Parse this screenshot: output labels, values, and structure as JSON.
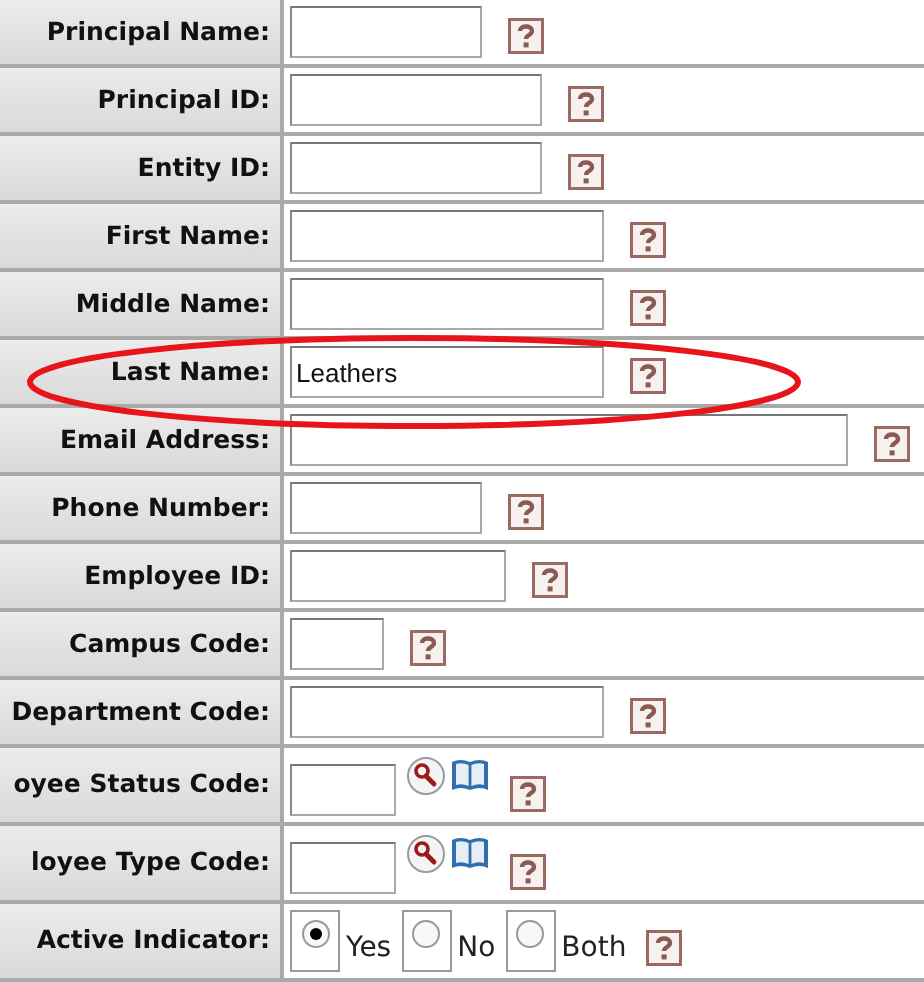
{
  "fields": [
    {
      "label": "Principal Name:",
      "kind": "text",
      "highlighted": false
    },
    {
      "label": "Principal ID:",
      "kind": "text",
      "highlighted": false
    },
    {
      "label": "Entity ID:",
      "kind": "text",
      "highlighted": false
    },
    {
      "label": "First Name:",
      "kind": "text",
      "highlighted": false
    },
    {
      "label": "Middle Name:",
      "kind": "text",
      "highlighted": false
    },
    {
      "label": "Last Name:",
      "kind": "text",
      "value": "Leathers",
      "highlighted": true
    },
    {
      "label": "Email Address:",
      "kind": "text",
      "highlighted": false
    },
    {
      "label": "Phone Number:",
      "kind": "text",
      "highlighted": false
    },
    {
      "label": "Employee ID:",
      "kind": "text",
      "highlighted": false
    },
    {
      "label": "Campus Code:",
      "kind": "text",
      "highlighted": false
    },
    {
      "label": "Department Code:",
      "kind": "text",
      "highlighted": false
    },
    {
      "label": "oyee Status Code:",
      "kind": "lookup",
      "highlighted": false
    },
    {
      "label": "loyee Type Code:",
      "kind": "lookup",
      "highlighted": false
    },
    {
      "label": "Active Indicator:",
      "kind": "radio",
      "highlighted": false,
      "options": [
        {
          "label": "Yes",
          "selected": true
        },
        {
          "label": "No",
          "selected": false
        },
        {
          "label": "Both",
          "selected": false
        }
      ]
    }
  ]
}
